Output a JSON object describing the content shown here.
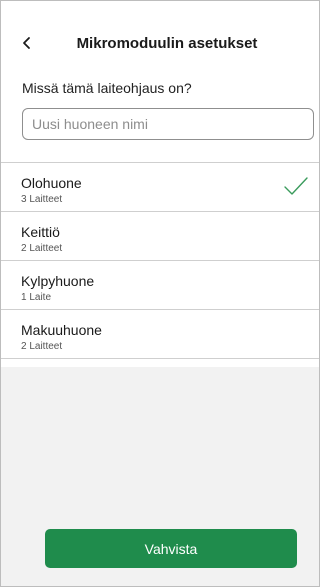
{
  "header": {
    "title": "Mikromoduulin asetukset",
    "back_icon": "chevron-left-icon"
  },
  "prompt": {
    "question": "Missä tämä laiteohjaus on?"
  },
  "new_room_input": {
    "placeholder": "Uusi huoneen nimi",
    "value": ""
  },
  "rooms": [
    {
      "name": "Olohuone",
      "count": "3  Laitteet",
      "selected": true
    },
    {
      "name": "Keittiö",
      "count": "2 Laitteet",
      "selected": false
    },
    {
      "name": "Kylpyhuone",
      "count": "1 Laite",
      "selected": false
    },
    {
      "name": "Makuuhuone",
      "count": "2  Laitteet",
      "selected": false
    }
  ],
  "actions": {
    "confirm_label": "Vahvista"
  },
  "colors": {
    "accent": "#1f8c4c",
    "check": "#3a9b5c"
  }
}
